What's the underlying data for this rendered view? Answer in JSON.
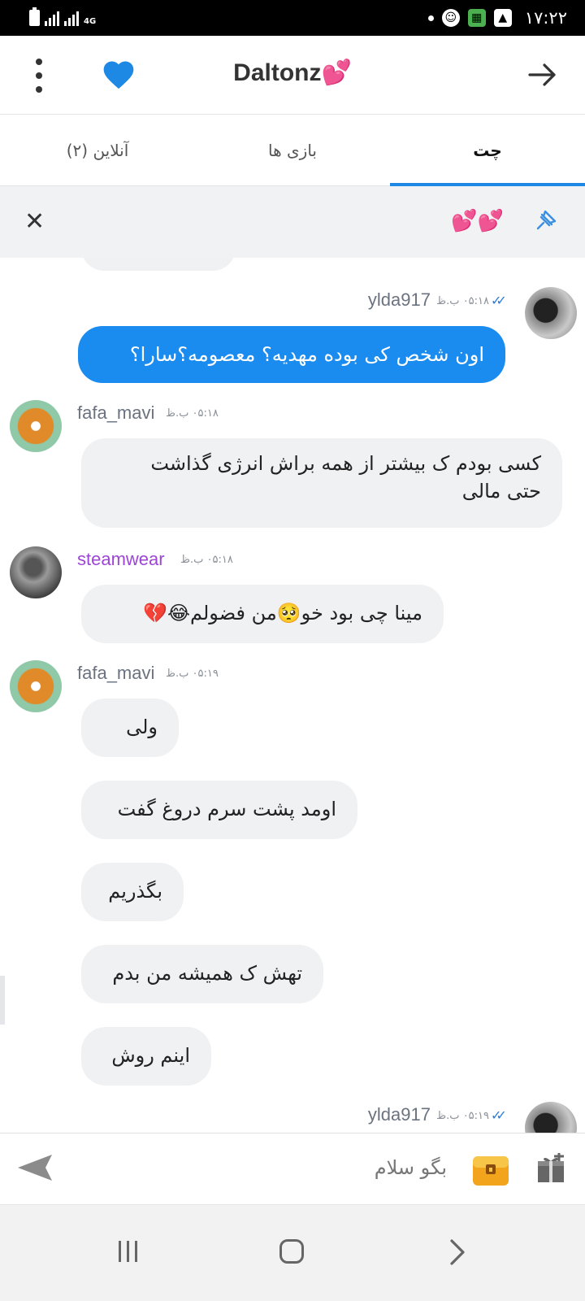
{
  "status_bar": {
    "network": "4G",
    "time": "۱۷:۲۲"
  },
  "header": {
    "title": "Daltonz💕"
  },
  "tabs": [
    {
      "label": "چت",
      "active": true
    },
    {
      "label": "بازی ها",
      "active": false
    },
    {
      "label": "آنلاین (۲)",
      "active": false
    }
  ],
  "pinned": {
    "text": "💕💕"
  },
  "messages": {
    "m1": {
      "username": "ylda917",
      "time": "۰۵:۱۸ ب.ظ",
      "text": "اون شخص کی بوده مهدیه؟ معصومه؟سارا؟"
    },
    "m2": {
      "username": "fafa_mavi",
      "time": "۰۵:۱۸ ب.ظ",
      "line1": "کسی بودم ک بیشتر از همه براش انرژی گذاشت",
      "line2": "حتی مالی"
    },
    "m3": {
      "username": "steamwear",
      "time": "۰۵:۱۸ ب.ظ",
      "text": "مینا چی بود خو🥺من فضولم😂💔"
    },
    "m4": {
      "username": "fafa_mavi",
      "time": "۰۵:۱۹ ب.ظ",
      "lines": [
        "ولی",
        "اومد پشت سرم دروغ گفت",
        "بگذریم",
        "تهش ک همیشه من بدم",
        "اینم روش"
      ]
    },
    "m5": {
      "username": "ylda917",
      "time": "۰۵:۱۹ ب.ظ"
    }
  },
  "input": {
    "placeholder": "بگو سلام"
  },
  "colors": {
    "accent": "#1e88e5",
    "outgoing_bubble": "#1a8cf0",
    "incoming_bubble": "#f0f1f3",
    "username_purple": "#9c45d8"
  },
  "icons": [
    "kebab-menu-icon",
    "heart-icon",
    "back-arrow-icon",
    "close-icon",
    "pin-icon",
    "send-icon",
    "chest-icon",
    "gift-icon"
  ]
}
